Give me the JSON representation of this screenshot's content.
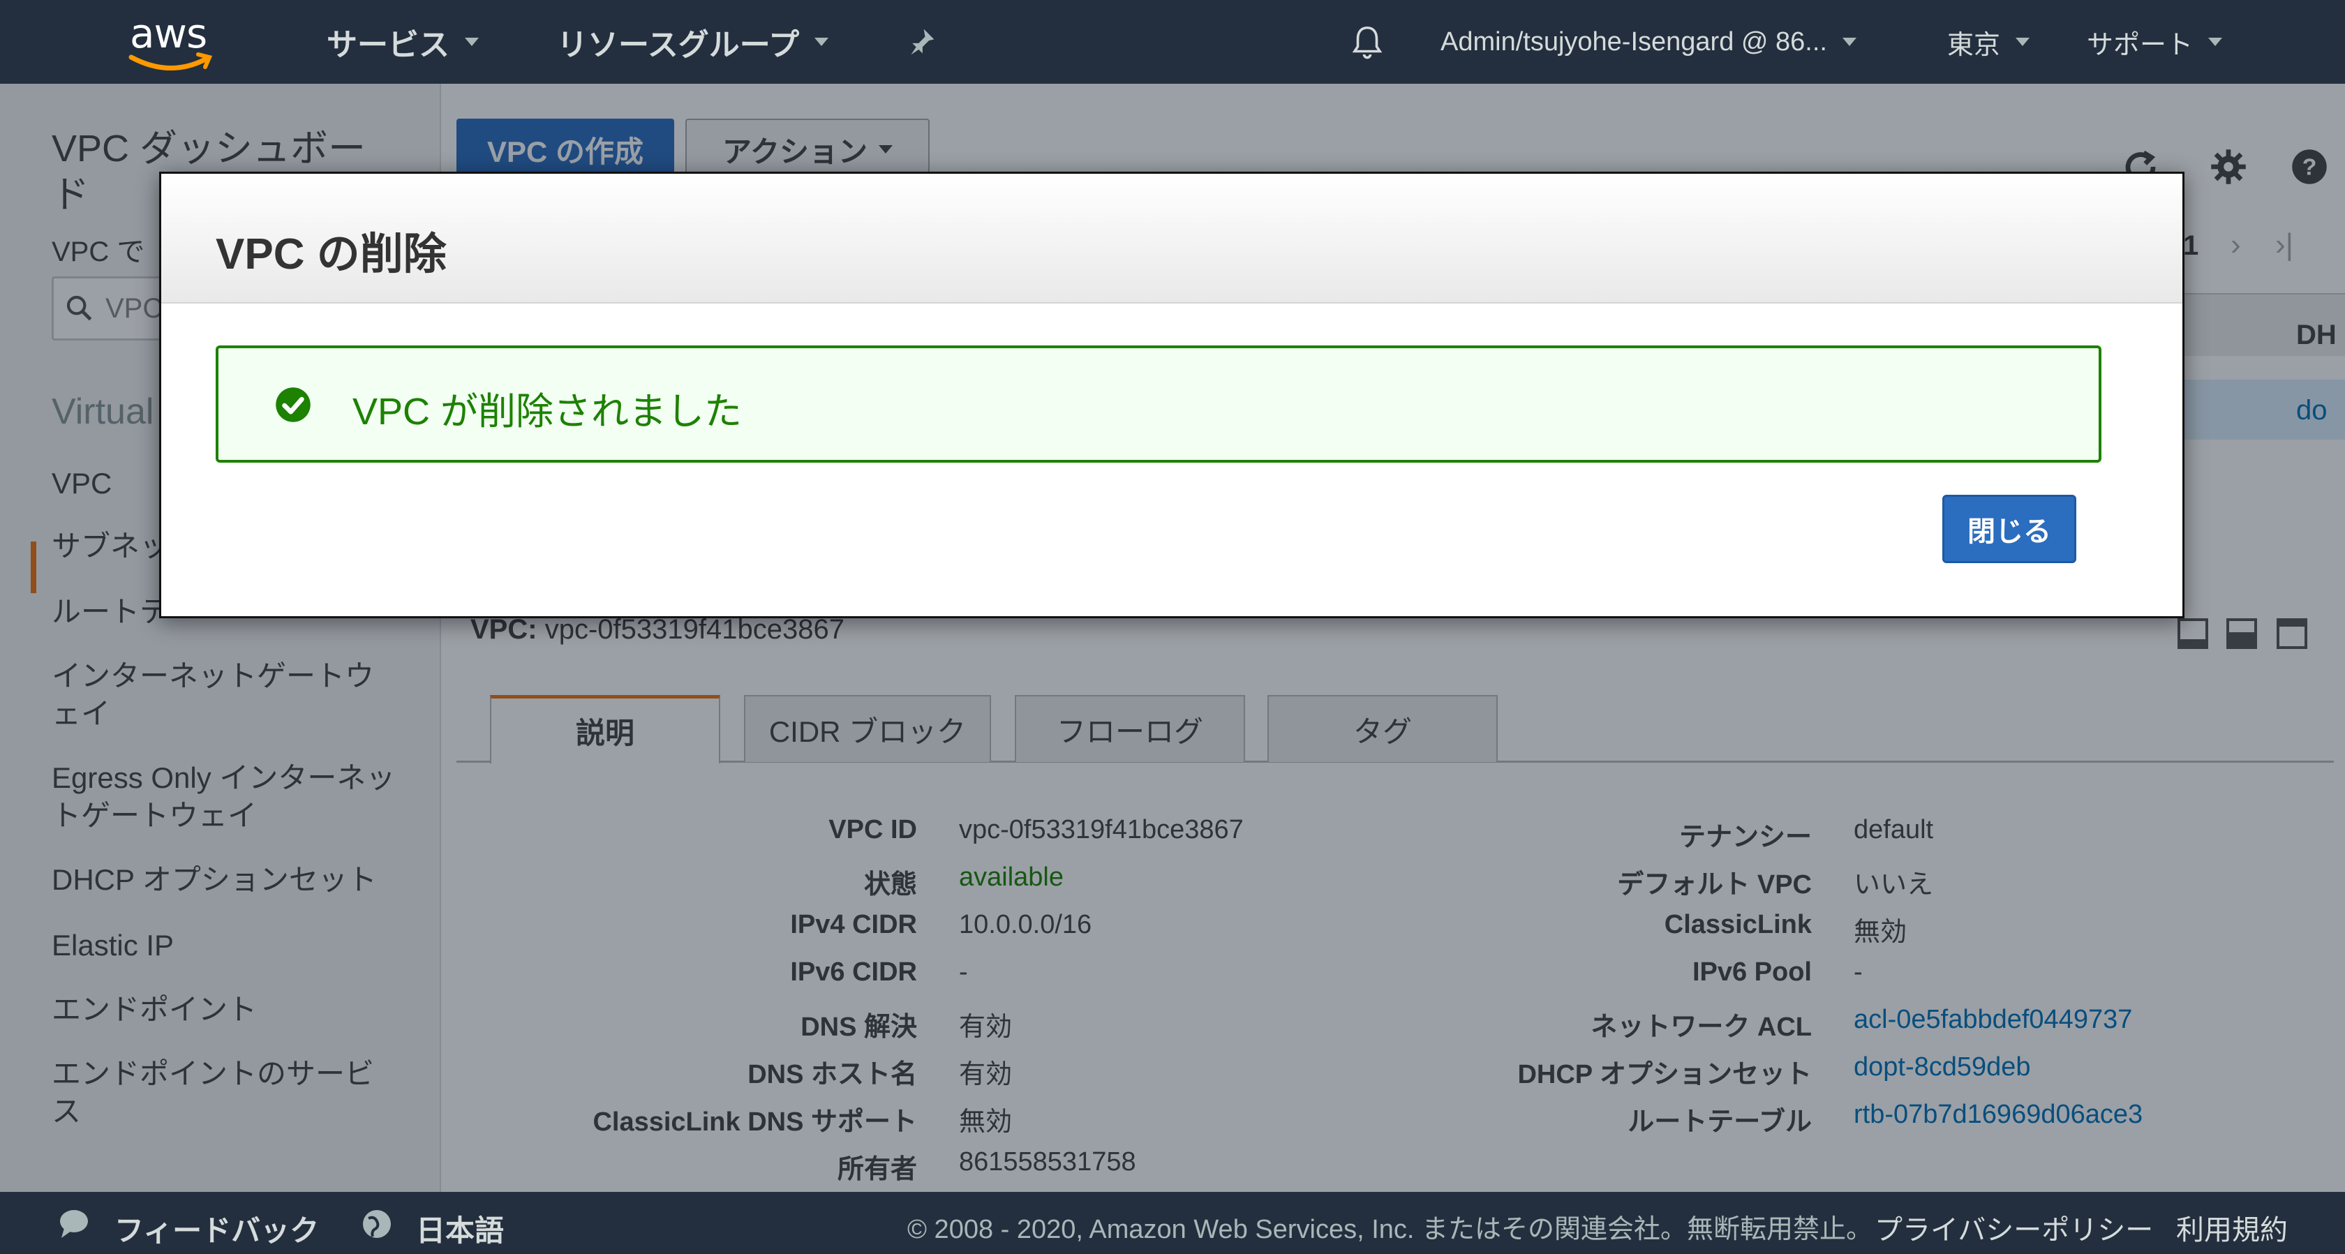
{
  "topnav": {
    "logo": "aws",
    "services": "サービス",
    "resource_groups": "リソースグループ",
    "account": "Admin/tsujyohe-Isengard @ 86...",
    "region": "東京",
    "support": "サポート"
  },
  "sidebar": {
    "title": "VPC ダッシュボード",
    "subtitle": "VPC で",
    "search_text": "VPC",
    "section": "Virtual",
    "items": [
      "VPC",
      "サブネッ",
      "ルートテ",
      "インターネットゲートウェイ",
      "Egress Only インターネットゲートウェイ",
      "DHCP オプションセット",
      "Elastic IP",
      "エンドポイント",
      "エンドポイントのサービス"
    ]
  },
  "toolbar": {
    "create_vpc": "VPC の作成",
    "actions": "アクション"
  },
  "detail": {
    "header_label": "VPC:",
    "header_value": "vpc-0f53319f41bce3867",
    "tabs": [
      "説明",
      "CIDR ブロック",
      "フローログ",
      "タグ"
    ],
    "left": [
      {
        "label": "VPC ID",
        "value": "vpc-0f53319f41bce3867"
      },
      {
        "label": "状態",
        "value": "available"
      },
      {
        "label": "IPv4 CIDR",
        "value": "10.0.0.0/16"
      },
      {
        "label": "IPv6 CIDR",
        "value": "-"
      },
      {
        "label": "DNS 解決",
        "value": "有効"
      },
      {
        "label": "DNS ホスト名",
        "value": "有効"
      },
      {
        "label": "ClassicLink DNS サポート",
        "value": "無効"
      },
      {
        "label": "所有者",
        "value": "861558531758"
      }
    ],
    "right": [
      {
        "label": "テナンシー",
        "value": "default"
      },
      {
        "label": "デフォルト VPC",
        "value": "いいえ"
      },
      {
        "label": "ClassicLink",
        "value": "無効"
      },
      {
        "label": "IPv6 Pool",
        "value": "-"
      },
      {
        "label": "ネットワーク ACL",
        "value": "acl-0e5fabbdef0449737"
      },
      {
        "label": "DHCP オプションセット",
        "value": "dopt-8cd59deb"
      },
      {
        "label": "ルートテーブル",
        "value": "rtb-07b7d16969d06ace3"
      }
    ],
    "peek_column_header": "DH",
    "peek_cell": "do",
    "peek_page": "1"
  },
  "modal": {
    "title": "VPC の削除",
    "message": "VPC が削除されました",
    "close_button": "閉じる"
  },
  "footer": {
    "feedback": "フィードバック",
    "language": "日本語",
    "copyright": "© 2008 - 2020, Amazon Web Services, Inc. またはその関連会社。無断転用禁止。",
    "privacy": "プライバシーポリシー",
    "terms": "利用規約"
  },
  "colors": {
    "nav_bg": "#232f3e",
    "primary_button": "#2b6dbf",
    "success_green": "#1d8102",
    "link_blue": "#0073bb",
    "accent_orange": "#ec7211"
  }
}
